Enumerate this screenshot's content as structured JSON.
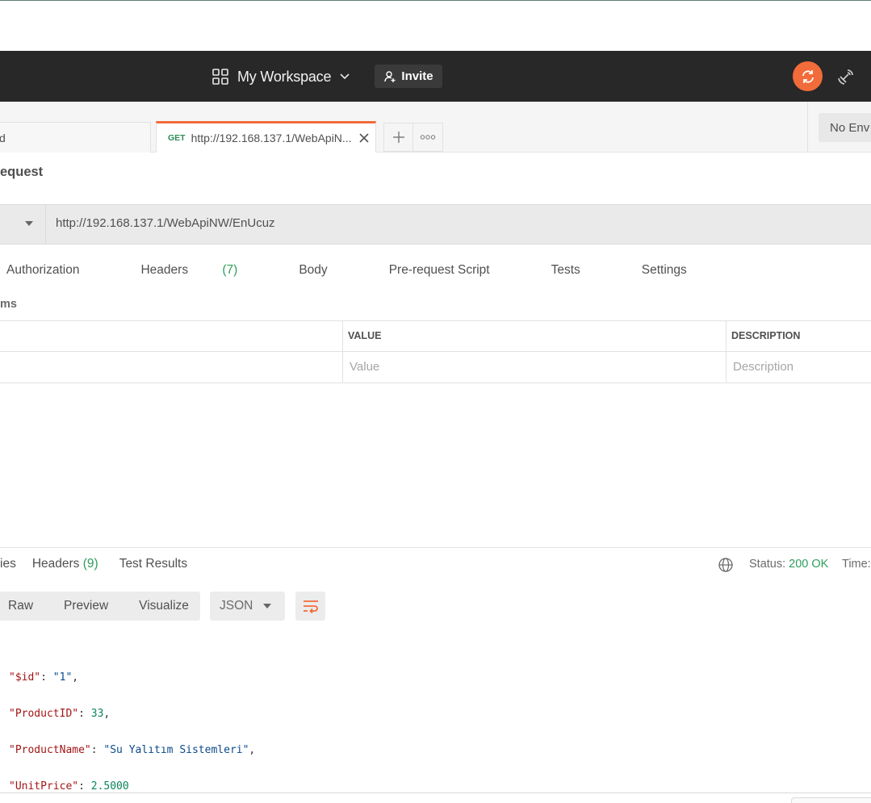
{
  "header": {
    "workspace_label": "My Workspace",
    "invite_label": "Invite",
    "sync_color": "#f26b3a"
  },
  "tabs": {
    "tab1_label": "d",
    "tab2_method": "GET",
    "tab2_url": "http://192.168.137.1/WebApiN...",
    "environment": "No Env"
  },
  "request": {
    "title": "equest",
    "url": "http://192.168.137.1/WebApiNW/EnUcuz",
    "tabs": [
      {
        "label": "Authorization",
        "count": ""
      },
      {
        "label": "Headers",
        "count": "(7)"
      },
      {
        "label": "Body",
        "count": ""
      },
      {
        "label": "Pre-request Script",
        "count": ""
      },
      {
        "label": "Tests",
        "count": ""
      },
      {
        "label": "Settings",
        "count": ""
      }
    ],
    "params_label": "ms",
    "params_table": {
      "columns": [
        "VALUE",
        "DESCRIPTION"
      ],
      "placeholders": {
        "value": "Value",
        "description": "Description"
      }
    }
  },
  "response": {
    "tabs": [
      {
        "label": "ies",
        "count": ""
      },
      {
        "label": "Headers",
        "count": "(9)"
      },
      {
        "label": "Test Results",
        "count": ""
      }
    ],
    "status_label": "Status:",
    "status_value": "200 OK",
    "time_label": "Time:",
    "view_modes": [
      "Raw",
      "Preview",
      "Visualize"
    ],
    "format": "JSON",
    "body": [
      {
        "key": "\"$id\"",
        "value": "\"1\"",
        "type": "s",
        "comma": ","
      },
      {
        "key": "\"ProductID\"",
        "value": "33",
        "type": "n",
        "comma": ","
      },
      {
        "key": "\"ProductName\"",
        "value": "\"Su Yalıtım Sistemleri\"",
        "type": "s",
        "comma": ","
      },
      {
        "key": "\"UnitPrice\"",
        "value": "2.5000",
        "type": "n",
        "comma": ""
      }
    ]
  }
}
